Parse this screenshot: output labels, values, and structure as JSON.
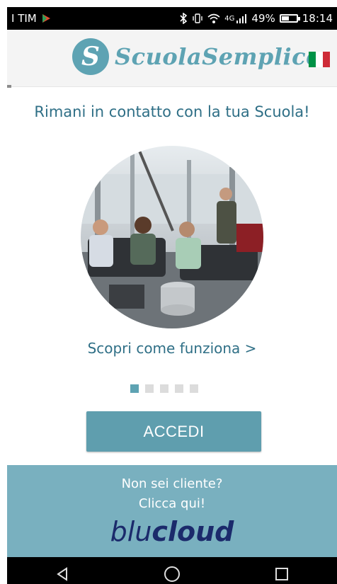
{
  "status_bar": {
    "carrier": "I TIM",
    "network": "4G",
    "battery_percent": "49%",
    "battery_level": 0.49,
    "time": "18:14",
    "icons": [
      "play-icon",
      "bluetooth-icon",
      "vibrate-icon",
      "wifi-icon",
      "signal-icon",
      "battery-icon"
    ]
  },
  "header": {
    "logo_letter": "S",
    "logo_text": "ScuolaSemplice",
    "flag_colors": [
      "#009246",
      "#ffffff",
      "#ce2b37"
    ]
  },
  "main": {
    "headline": "Rimani in contatto con la tua Scuola!",
    "discover_link": "Scopri come funziona >",
    "carousel": {
      "pages": 5,
      "active_index": 0
    },
    "login_button": "ACCEDI"
  },
  "promo": {
    "line1": "Non sei cliente?",
    "line2": "Clicca qui!",
    "brand_part1": "blu",
    "brand_part2": "cloud"
  },
  "colors": {
    "accent": "#5ea3b3",
    "headline": "#2f6f86",
    "promo_bg": "#79b0bf",
    "brand": "#1b2a6b"
  },
  "nav_bar": {
    "icons": [
      "back-icon",
      "home-icon",
      "recents-icon"
    ]
  }
}
